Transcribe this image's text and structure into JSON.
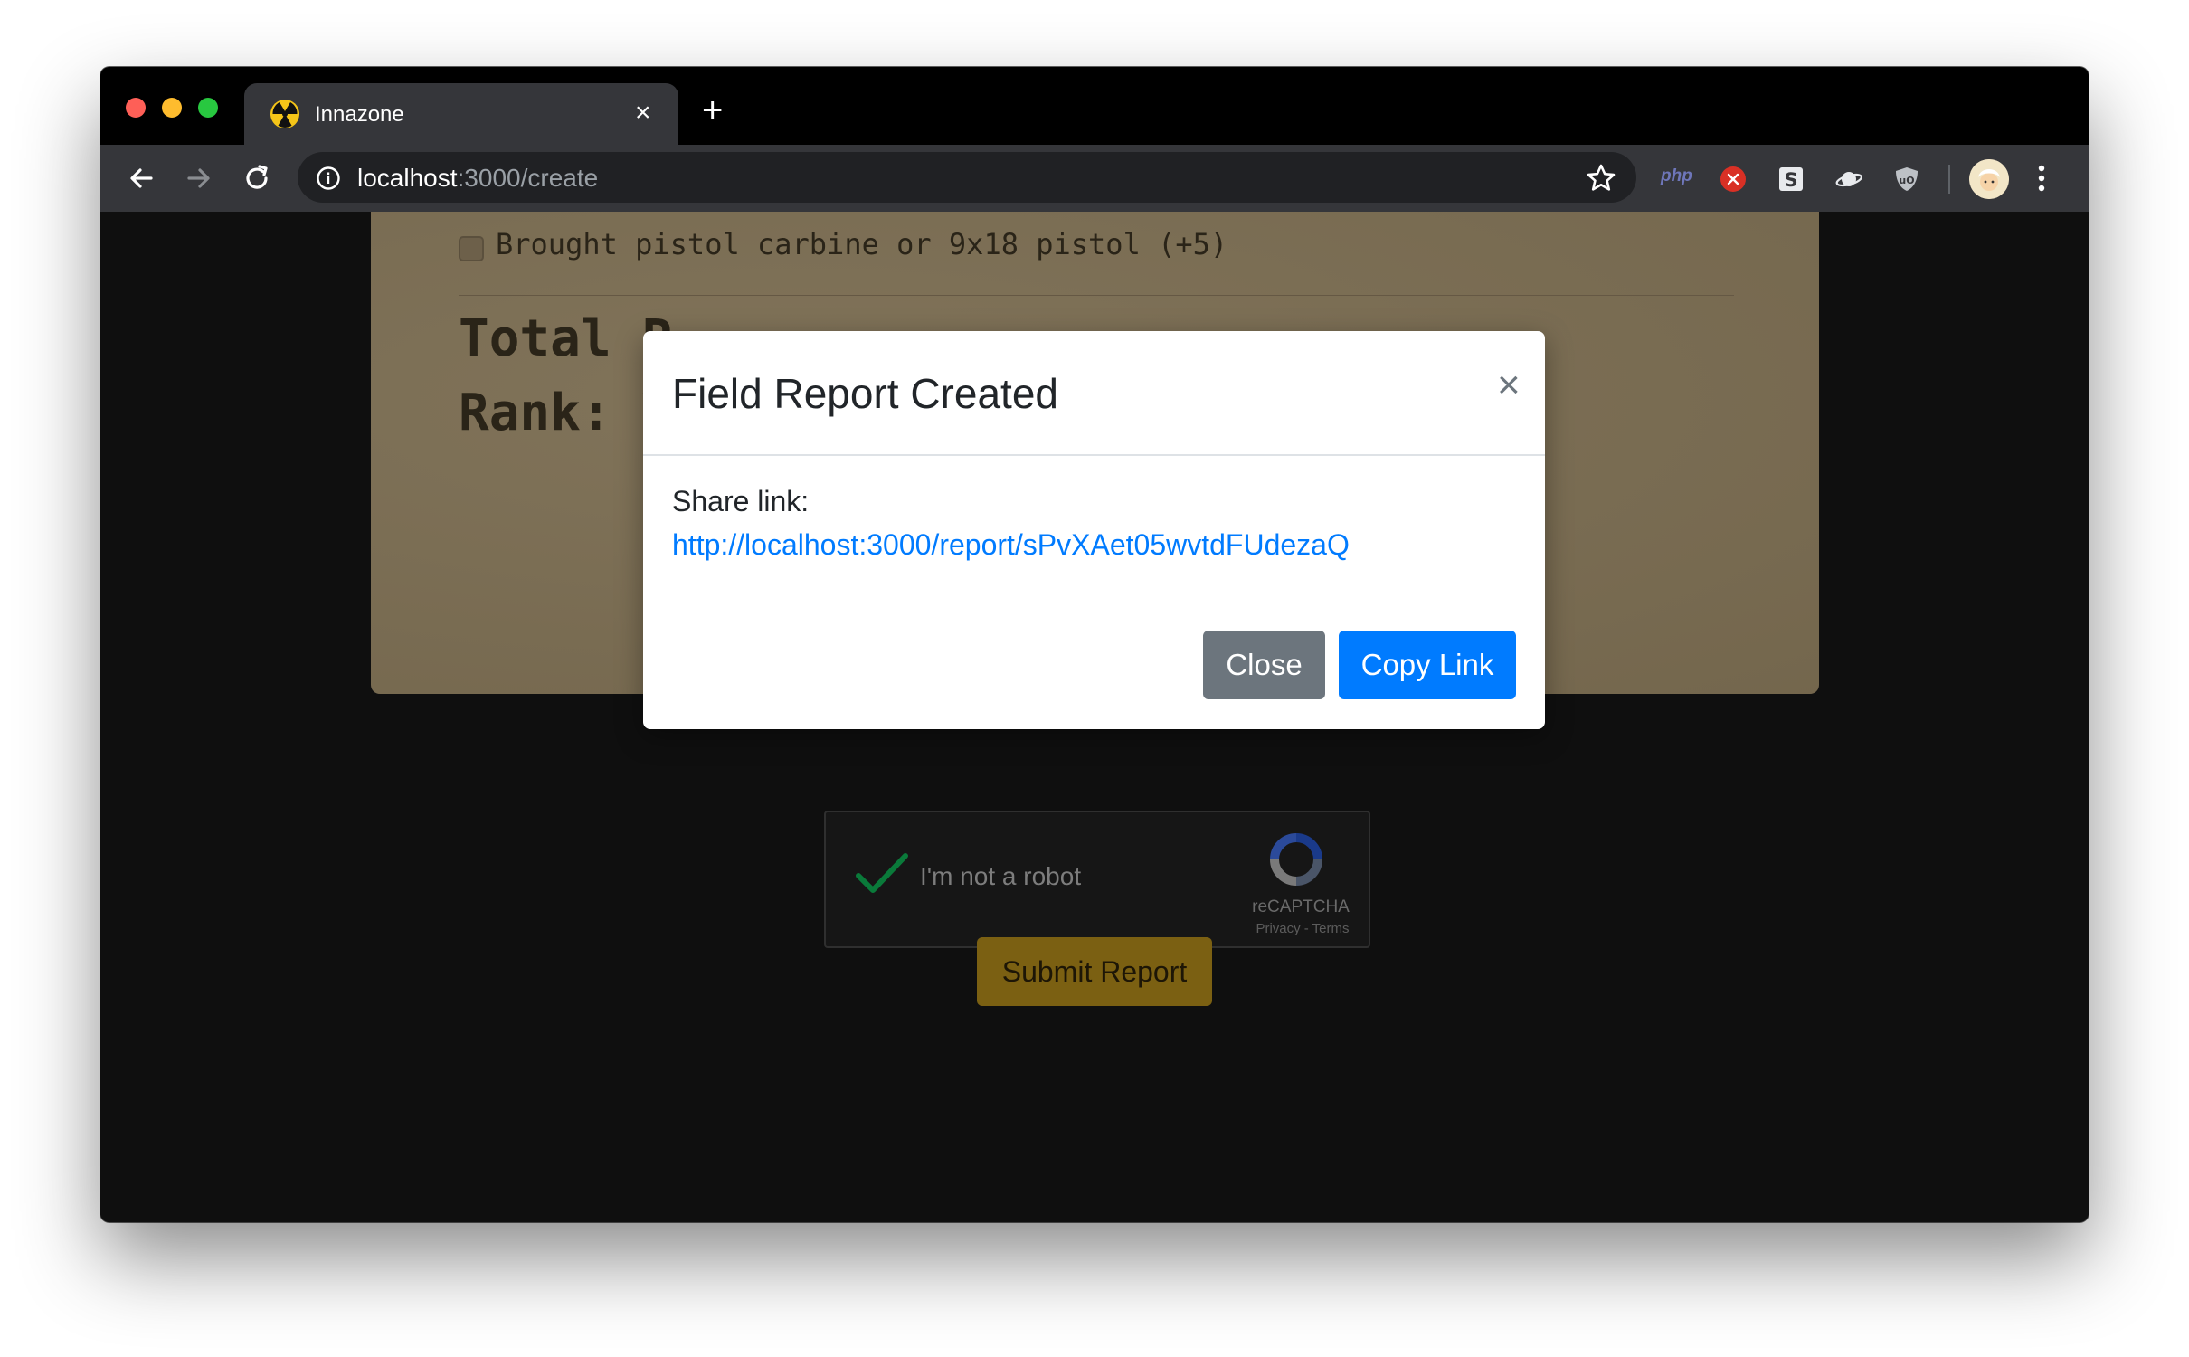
{
  "browser": {
    "tab_title": "Innazone",
    "tab_close": "×",
    "new_tab": "+",
    "url_host": "localhost",
    "url_rest": ":3000/create",
    "extensions": {
      "php_label": "php"
    }
  },
  "page": {
    "checkbox_item": "Brought pistol carbine or 9x18 pistol (+5)",
    "total_label": "Total P",
    "rank_label": "Rank: V"
  },
  "recaptcha": {
    "label": "I'm not a robot",
    "brand": "reCAPTCHA",
    "links": "Privacy - Terms"
  },
  "submit_label": "Submit Report",
  "modal": {
    "title": "Field Report Created",
    "close_x": "×",
    "share_label": "Share link:",
    "share_url": "http://localhost:3000/report/sPvXAet05wvtdFUdezaQ",
    "close_button": "Close",
    "copy_button": "Copy Link"
  },
  "colors": {
    "primary": "#007bff",
    "secondary": "#6c757d",
    "submit": "#7b6012",
    "paper": "#7a6c51"
  }
}
